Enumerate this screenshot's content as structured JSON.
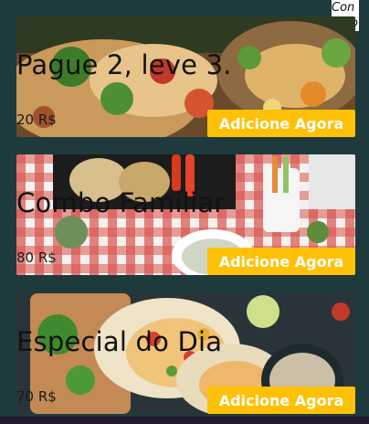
{
  "corner_note": {
    "line1": "Con",
    "line2": "vero"
  },
  "products": [
    {
      "title": "Pague 2, leve 3.",
      "price": "20 R$",
      "button_label": "Adicione Agora"
    },
    {
      "title": "Combo Familiar",
      "price": "80 R$",
      "button_label": "Adicione Agora"
    },
    {
      "title": "Especial do Dia",
      "price": "70 R$",
      "button_label": "Adicione Agora"
    }
  ],
  "colors": {
    "page_background": "#1e3a3c",
    "button": "#ffc107",
    "button_text": "#ffffff",
    "title_text": "#121212",
    "bottom_strip": "#24172e"
  }
}
